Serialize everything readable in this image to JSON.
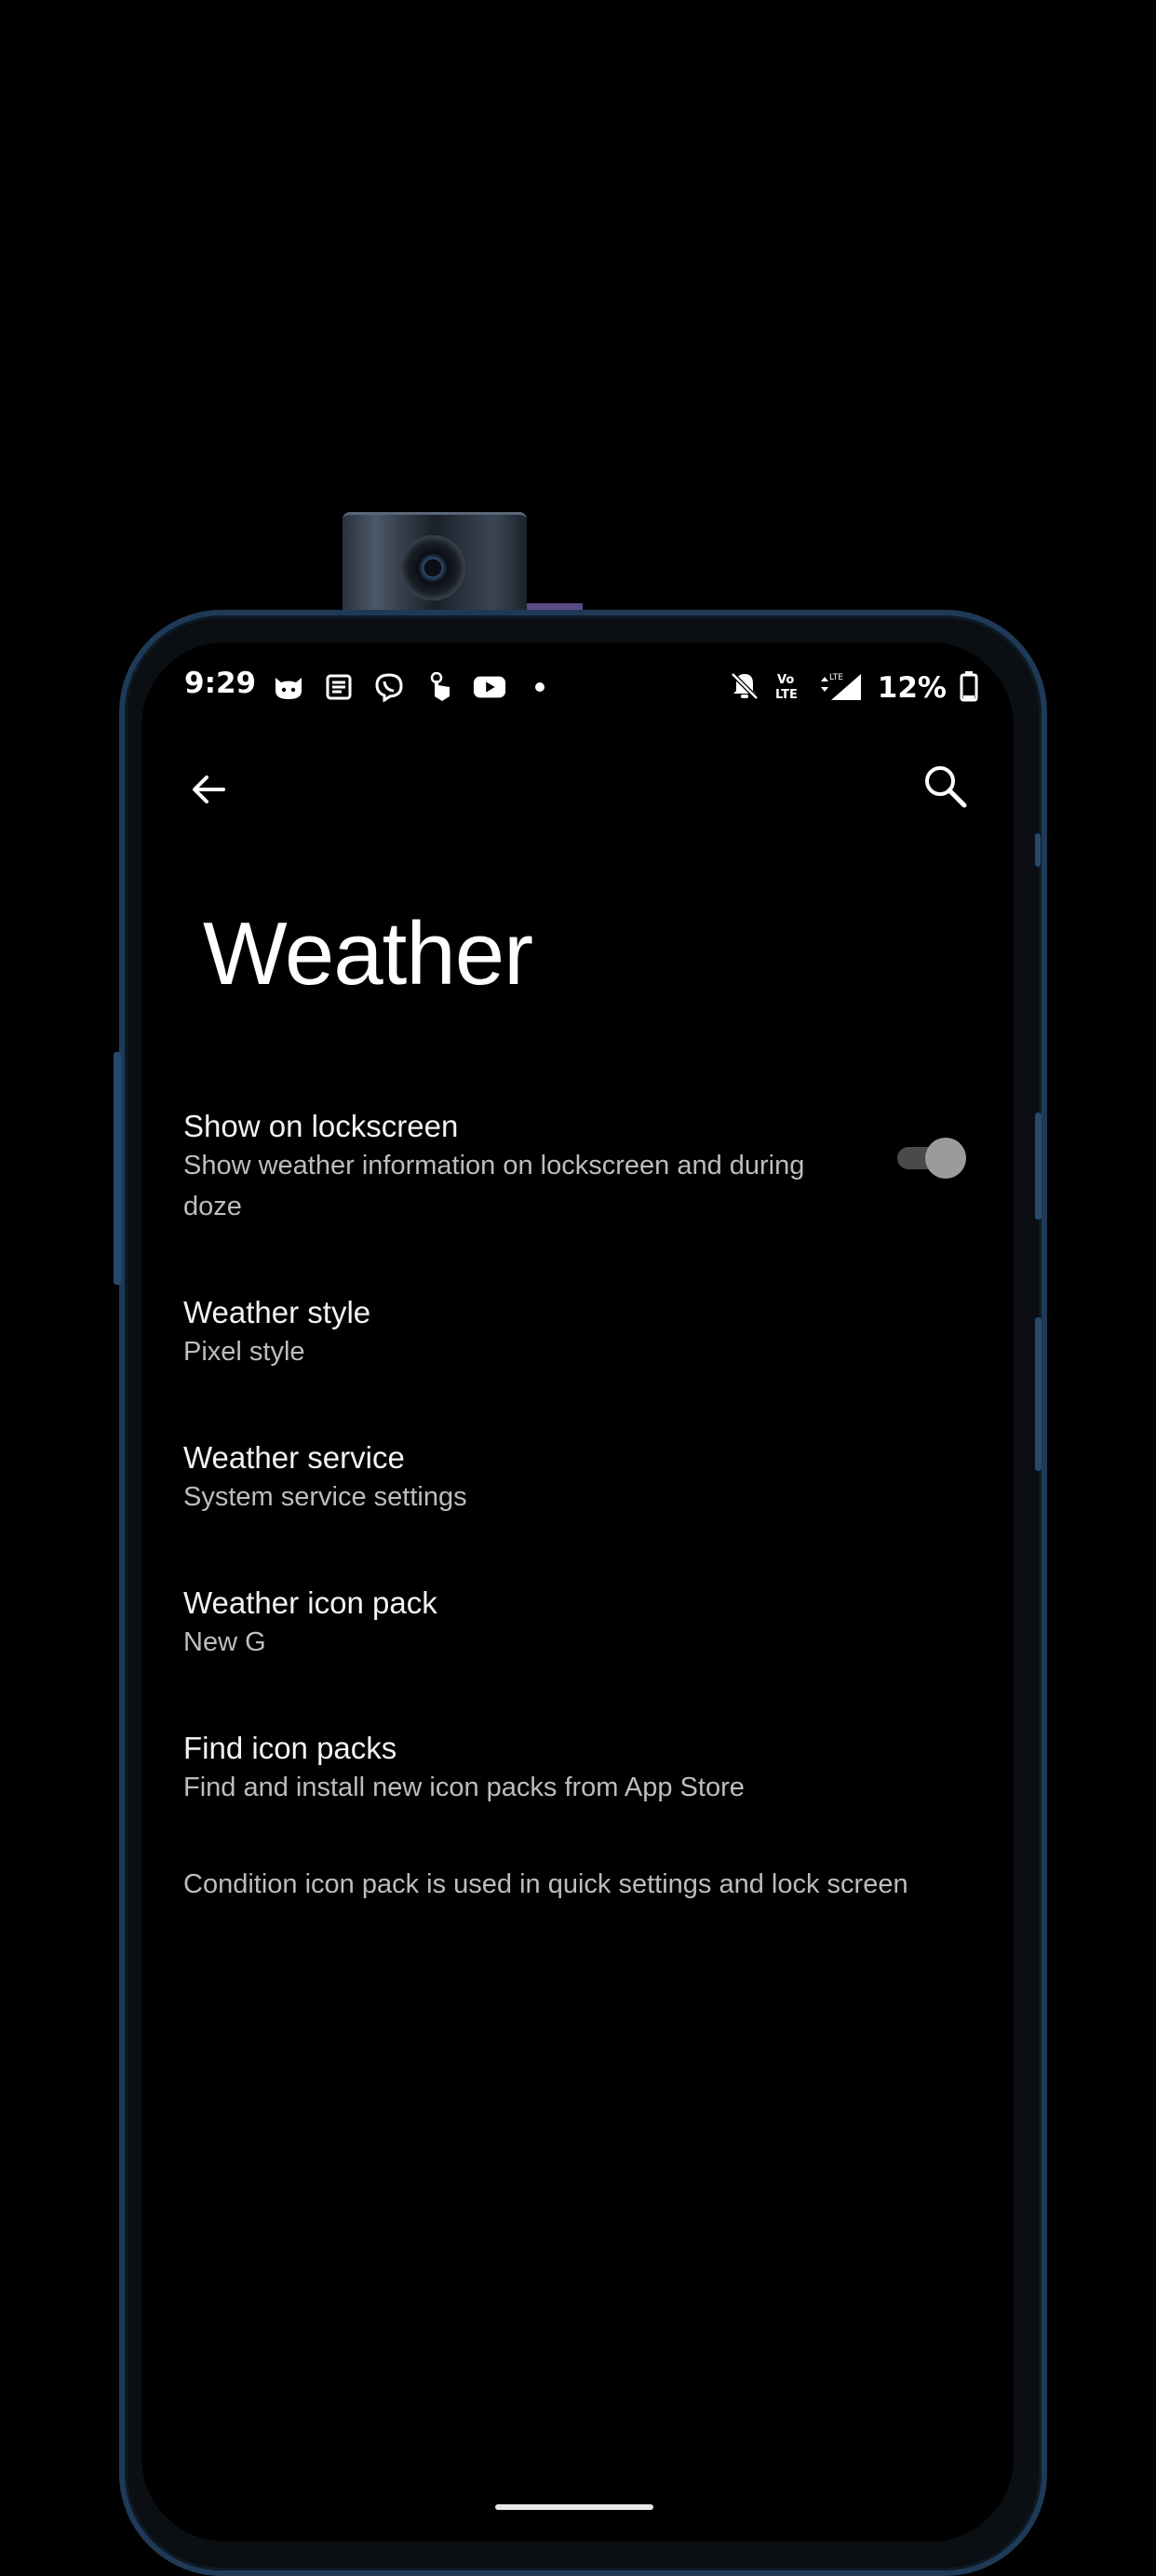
{
  "status_bar": {
    "time": "9:29",
    "notification_icons": [
      "cat-app-icon",
      "news-icon",
      "viber-icon",
      "touch-icon",
      "youtube-icon",
      "dot-icon"
    ],
    "right_icons": [
      "bell-off-icon",
      "volte-icon",
      "signal-icon"
    ],
    "volte_label": "Vo))\nLTE",
    "battery_percent": "12%"
  },
  "app_bar": {
    "back_icon": "arrow-left-icon",
    "search_icon": "search-icon"
  },
  "page": {
    "title": "Weather"
  },
  "preferences": [
    {
      "title": "Show on lockscreen",
      "summary": "Show weather information on lockscreen and during doze",
      "toggle_on": false
    },
    {
      "title": "Weather style",
      "summary": "Pixel style"
    },
    {
      "title": "Weather service",
      "summary": "System service settings"
    },
    {
      "title": "Weather icon pack",
      "summary": "New G"
    },
    {
      "title": "Find icon packs",
      "summary": "Find and install new icon packs from App Store"
    }
  ],
  "footer": {
    "note": "Condition icon pack is used in quick settings and lock screen"
  },
  "colors": {
    "background": "#000000",
    "frame": "#1f3a57",
    "text_primary": "#f3f3f3",
    "text_secondary": "#bdbdbd"
  }
}
